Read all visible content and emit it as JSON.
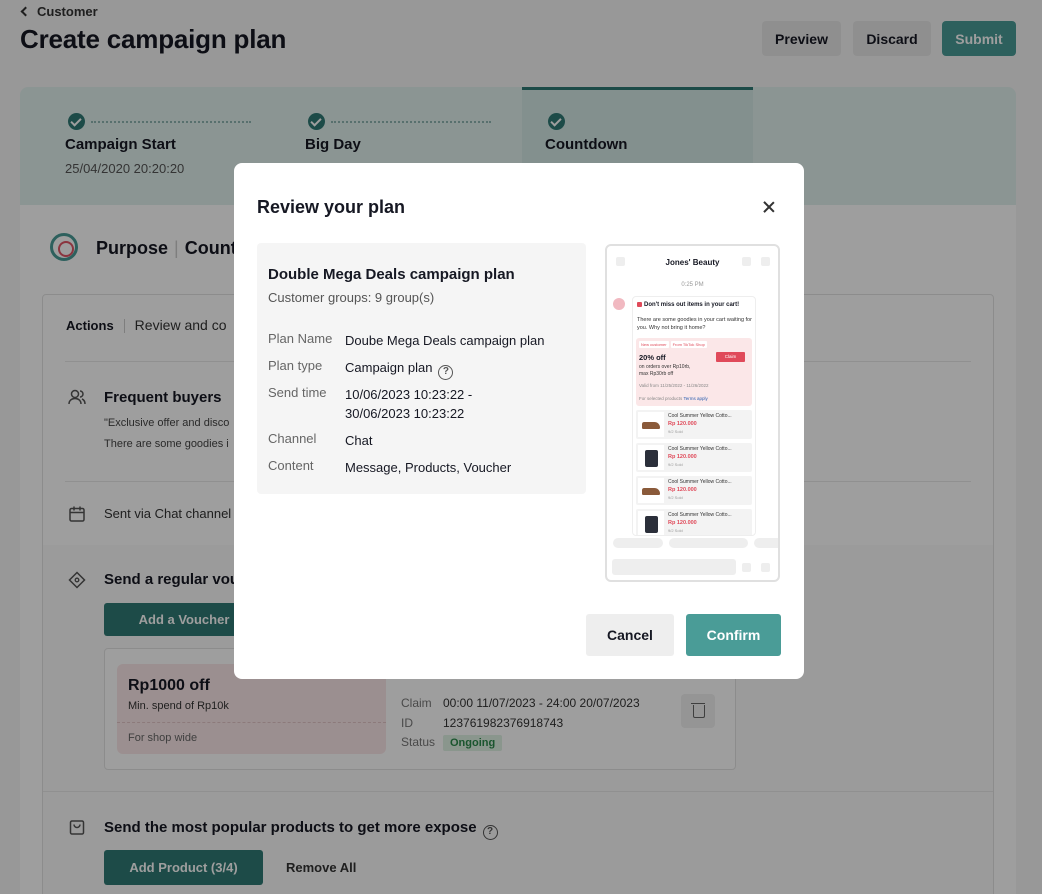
{
  "header": {
    "back_label": "Customer",
    "title": "Create campaign plan",
    "preview_label": "Preview",
    "discard_label": "Discard",
    "submit_label": "Submit"
  },
  "stepper": {
    "steps": [
      {
        "title": "Campaign Start",
        "date": "25/04/2020 20:20:20"
      },
      {
        "title": "Big Day",
        "date": ""
      },
      {
        "title": "Countdown",
        "date": ""
      }
    ]
  },
  "purpose": {
    "title_part1": "Purpose",
    "title_part2": "Count"
  },
  "actions": {
    "tab_actions": "Actions",
    "tab_review": "Review and co",
    "frequent_buyers_title": "Frequent buyers",
    "frequent_buyers_line1": "\"Exclusive offer and disco",
    "frequent_buyers_line2": "There are some goodies i",
    "sent_via": "Sent via Chat channel",
    "voucher_section_title": "Send a regular vou",
    "add_voucher_label": "Add a Voucher",
    "voucher": {
      "amount": "Rp1000 off",
      "min_spend": "Min. spend of Rp10k",
      "scope": "For shop wide",
      "claim_label": "Claim",
      "claim_value": "00:00 11/07/2023 - 24:00 20/07/2023",
      "id_label": "ID",
      "id_value": "123761982376918743",
      "status_label": "Status",
      "status_value": "Ongoing"
    },
    "products_section_title": "Send the most popular products to get more expose",
    "add_product_label": "Add Product (3/4)",
    "remove_all_label": "Remove All"
  },
  "modal": {
    "title": "Review your plan",
    "plan_title": "Double Mega Deals campaign plan",
    "customer_groups": "Customer groups: 9 group(s)",
    "fields": [
      {
        "key": "Plan Name",
        "value": "Doube Mega Deals campaign plan"
      },
      {
        "key": "Plan type",
        "value": "Campaign plan"
      },
      {
        "key": "Send time",
        "value": "10/06/2023 10:23:22 -\n30/06/2023 10:23:22"
      },
      {
        "key": "Channel",
        "value": "Chat"
      },
      {
        "key": "Content",
        "value": "Message, Products, Voucher"
      }
    ],
    "cancel_label": "Cancel",
    "confirm_label": "Confirm",
    "preview": {
      "shop_name": "Jones' Beauty",
      "time": "0:25 PM",
      "headline": "Don't miss out items in your cart!",
      "message": "There are some goodies in your cart waiting for you. Why not bring it home?",
      "tag1": "New customer",
      "tag2": "From TikTok Shop",
      "off": "20% off",
      "claim": "Claim",
      "condition1": "on orders over Rp10rb,",
      "condition2": "max Rp30rb off",
      "valid": "Valid from 11/25/2022 - 11/26/2022",
      "selected": "For selected products",
      "terms": "Terms apply",
      "products": [
        {
          "title": "Cool Summer Yellow Cotto...",
          "price": "Rp 120.000",
          "sold": "9/2 Sold"
        },
        {
          "title": "Cool Summer Yellow Cotto...",
          "price": "Rp 120.000",
          "sold": "9/2 Sold"
        },
        {
          "title": "Cool Summer Yellow Cotto...",
          "price": "Rp 120.000",
          "sold": "9/2 Sold"
        },
        {
          "title": "Cool Summer Yellow Cotto...",
          "price": "Rp 120.000",
          "sold": "9/2 Sold"
        }
      ]
    }
  },
  "colors": {
    "accent": "#4a9c97",
    "accent_dark": "#2f7a75",
    "danger": "#e04a5a",
    "stepper_bg": "#e1f0ee"
  }
}
